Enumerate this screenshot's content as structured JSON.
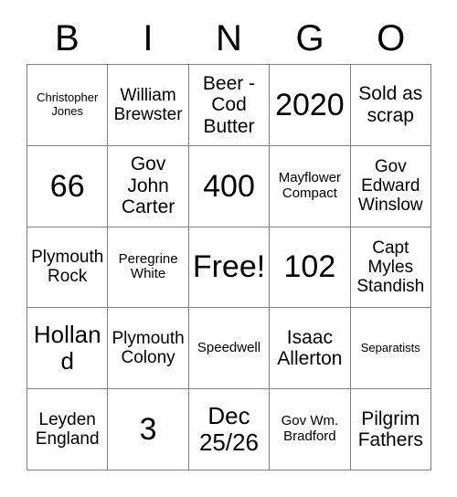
{
  "card": {
    "title_letters": [
      "B",
      "I",
      "N",
      "G",
      "O"
    ],
    "free_space_label": "Free!",
    "grid": {
      "rows": 5,
      "columns": 5
    },
    "cells": [
      {
        "text": "Christopher Jones",
        "size": "fs-xs"
      },
      {
        "text": "William Brewster",
        "size": "fs-m"
      },
      {
        "text": "Beer - Cod Butter",
        "size": "fs-l"
      },
      {
        "text": "2020",
        "size": "fs-xxl"
      },
      {
        "text": "Sold as scrap",
        "size": "fs-l"
      },
      {
        "text": "66",
        "size": "fs-xxl"
      },
      {
        "text": "Gov John Carter",
        "size": "fs-l"
      },
      {
        "text": "400",
        "size": "fs-xxl"
      },
      {
        "text": "Mayflower Compact",
        "size": "fs-s"
      },
      {
        "text": "Gov Edward Winslow",
        "size": "fs-m"
      },
      {
        "text": "Plymouth Rock",
        "size": "fs-m"
      },
      {
        "text": "Peregrine White",
        "size": "fs-s"
      },
      {
        "text": "Free!",
        "size": "fs-xxl"
      },
      {
        "text": "102",
        "size": "fs-xxl"
      },
      {
        "text": "Capt Myles Standish",
        "size": "fs-m"
      },
      {
        "text": "Holland",
        "size": "fs-xl"
      },
      {
        "text": "Plymouth Colony",
        "size": "fs-m"
      },
      {
        "text": "Speedwell",
        "size": "fs-s"
      },
      {
        "text": "Isaac Allerton",
        "size": "fs-l"
      },
      {
        "text": "Separatists",
        "size": "fs-xs"
      },
      {
        "text": "Leyden England",
        "size": "fs-m"
      },
      {
        "text": "3",
        "size": "fs-xxl"
      },
      {
        "text": "Dec 25/26",
        "size": "fs-xl"
      },
      {
        "text": "Gov Wm. Bradford",
        "size": "fs-s"
      },
      {
        "text": "Pilgrim Fathers",
        "size": "fs-l"
      }
    ]
  },
  "colors": {
    "background": "#ffffff",
    "text": "#000000",
    "grid_line": "#808080"
  }
}
